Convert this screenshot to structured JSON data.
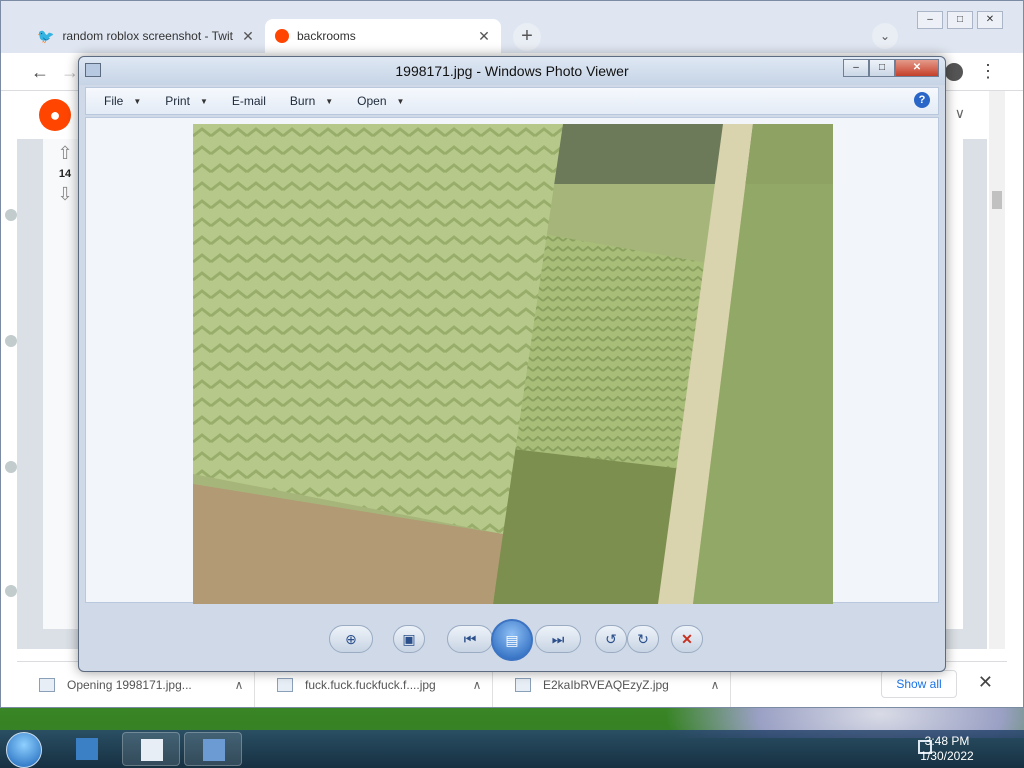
{
  "browser": {
    "tabs": [
      {
        "title": "random roblox screenshot - Twit",
        "active": false,
        "icon": "twitter-icon",
        "color": "#1da1f2"
      },
      {
        "title": "backrooms",
        "active": true,
        "icon": "reddit-icon",
        "color": "#ff4500"
      }
    ],
    "new_tab_label": "+",
    "address_icon": "arrow-left-icon"
  },
  "reddit": {
    "vote_count": "14",
    "logo_color": "#ff4500"
  },
  "photo_viewer": {
    "title": "1998171.jpg - Windows Photo Viewer",
    "menu": [
      {
        "label": "File",
        "has_dropdown": true
      },
      {
        "label": "Print",
        "has_dropdown": true
      },
      {
        "label": "E-mail",
        "has_dropdown": false
      },
      {
        "label": "Burn",
        "has_dropdown": true
      },
      {
        "label": "Open",
        "has_dropdown": true
      }
    ],
    "help_label": "?",
    "controls": [
      "zoom-icon",
      "actual-size-icon",
      "previous-icon",
      "slideshow-icon",
      "next-icon",
      "rotate-left-icon",
      "rotate-right-icon",
      "delete-icon"
    ]
  },
  "downloads": {
    "items": [
      {
        "name": "Opening 1998171.jpg..."
      },
      {
        "name": "fuck.fuck.fuckfuck.f....jpg"
      },
      {
        "name": "E2kaIbRVEAQEzyZ.jpg"
      }
    ],
    "show_all": "Show all"
  },
  "taskbar": {
    "time": "3:48 PM",
    "date": "1/30/2022"
  }
}
